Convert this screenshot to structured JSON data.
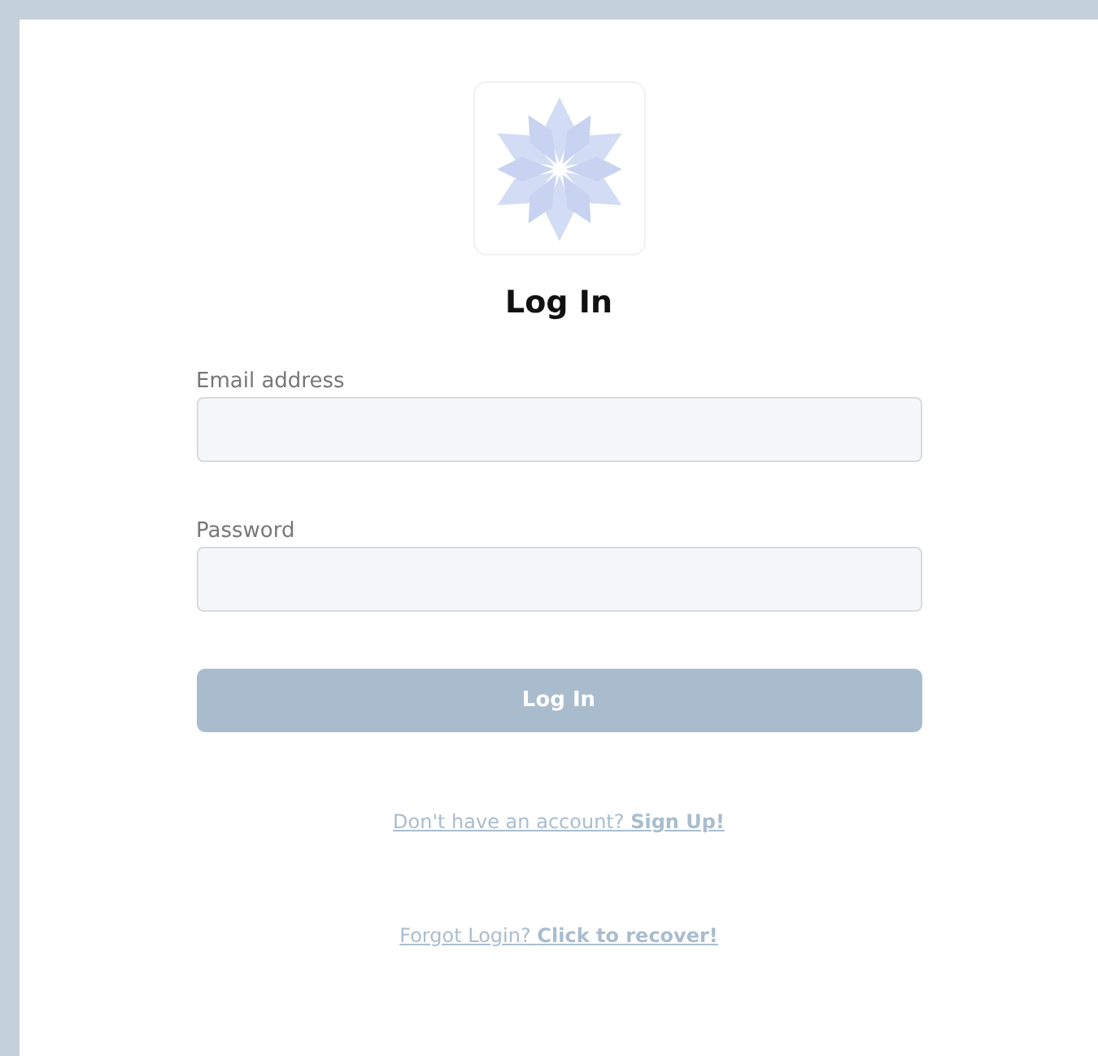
{
  "title": "Log In",
  "fields": [
    {
      "label": "Email address"
    },
    {
      "label": "Password"
    }
  ],
  "submit_button": {
    "label": "Log In",
    "disabled": true
  },
  "links": [
    {
      "text": "Don't have an account? **Sign Up!**"
    },
    {
      "text": "Forgot Login? **Click to recover!**"
    }
  ]
}
